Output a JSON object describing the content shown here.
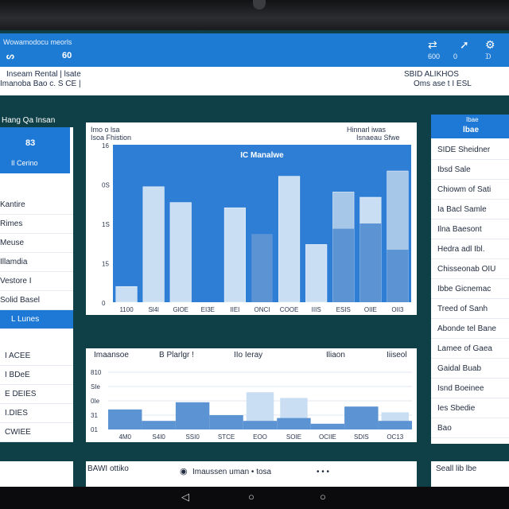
{
  "appbar": {
    "title_small": "Wowamodocu meorls",
    "left_label_1": "ᔕ",
    "left_label_2": "60",
    "icon1": "share-icon",
    "icon2": "cursor-icon",
    "icon3": "settings-icon",
    "icon1_label": "600",
    "icon2_label": "0",
    "icon3_label": "ᗪ"
  },
  "subbar": {
    "left_line_1": "Inseam Rental | lsate",
    "left_line_2": "Imanoba Bao c. S CE |",
    "right_line_1": "SBID ALIKHOS",
    "right_line_2": "Oms ase t I ESL"
  },
  "left_panel": {
    "title": "Hang Qa Insan",
    "head_value": "83",
    "head_label": "Il Cerino",
    "items": [
      "Kantire",
      "Rimes",
      "Meuse",
      "Illamdia",
      "Vestore I",
      "Solid Basel"
    ],
    "selected": "L Lunes",
    "items_lower": [
      "I ACEE",
      "I BDeE",
      "E DEIES",
      "I.DIES",
      "CWIEE"
    ]
  },
  "right_panel": {
    "head_small": "Ibae",
    "head_value": "lbae",
    "items": [
      "SIDE Sheidner",
      "Ibsd Sale",
      "Chiowm of Sati",
      "Ia Bacl Samle",
      "Ilna Baesont",
      "Hedra adl Ibl.",
      "Chisseonab OIU",
      "Ibbe Gicnemac",
      "Treed of Sanh",
      "Abonde tel Bane",
      "Lamee of Gaea",
      "Gaidal Buab",
      "Isnd Boeinee",
      "Ies Sbedie",
      "Bao"
    ]
  },
  "chart1": {
    "header_left_1": "Imo o lsa",
    "header_left_2": "Isoa Fhistion",
    "header_right_1": "Hinnarl iwas",
    "header_right_2": "Isnaeau Sfwe",
    "title": "IC Manalwe"
  },
  "chart2": {
    "tabs": [
      "Imaansoe",
      "B Plarlgr !",
      "IIo Ieray",
      "Iliaon",
      "Iiiseol"
    ]
  },
  "footer": {
    "left_label": "",
    "mid_label_1": "BAWI ottiko",
    "mid_label_2": "Imaussen uman • tosa",
    "mid_label_3": "• • •",
    "right_label": "Seall lib lbe"
  },
  "navbar": {
    "back": "◁",
    "home": "○",
    "recent": "○"
  },
  "chart_data": [
    {
      "type": "bar",
      "title": "IC Manalwe",
      "ylim": [
        0,
        15
      ],
      "y_ticks": [
        "0",
        "15",
        "1S",
        "0S",
        "16"
      ],
      "categories": [
        "1100",
        "Sl4l",
        "GlOE",
        "EI3E",
        "IIEI",
        "ONCI",
        "COOE",
        "IIIS",
        "ESIS",
        "OIIE",
        "OII3"
      ],
      "series": [
        {
          "values": [
            1.5,
            11,
            9.5,
            0,
            9,
            0,
            12,
            5.5,
            10.5,
            10,
            12.5
          ]
        },
        {
          "values": [
            0,
            0,
            0,
            0,
            0,
            6.5,
            0,
            0,
            7,
            7.5,
            5
          ]
        }
      ],
      "colors": {
        "bar_light": "#c9def2",
        "bar_mid": "#a7c7e8",
        "bar_dark": "#5b93d3",
        "plot_bg": "#2f7ed6"
      }
    },
    {
      "type": "area",
      "ylim": [
        0,
        20
      ],
      "y_ticks": [
        "01",
        "31",
        "0Ie",
        "SIe",
        "810"
      ],
      "categories": [
        "4M0",
        "S4I0",
        "SSI0",
        "STCE",
        "EOO",
        "SOIE",
        "OCIIE",
        "SDIS",
        "OC13"
      ],
      "series": [
        {
          "values": [
            7,
            3,
            9.5,
            5,
            3,
            4,
            2,
            8,
            3
          ]
        },
        {
          "values": [
            0,
            0,
            0,
            0,
            13,
            11,
            0,
            0,
            6
          ]
        }
      ],
      "colors": {
        "fill_dark": "#5b93d3",
        "fill_light": "#c9def2"
      }
    }
  ]
}
